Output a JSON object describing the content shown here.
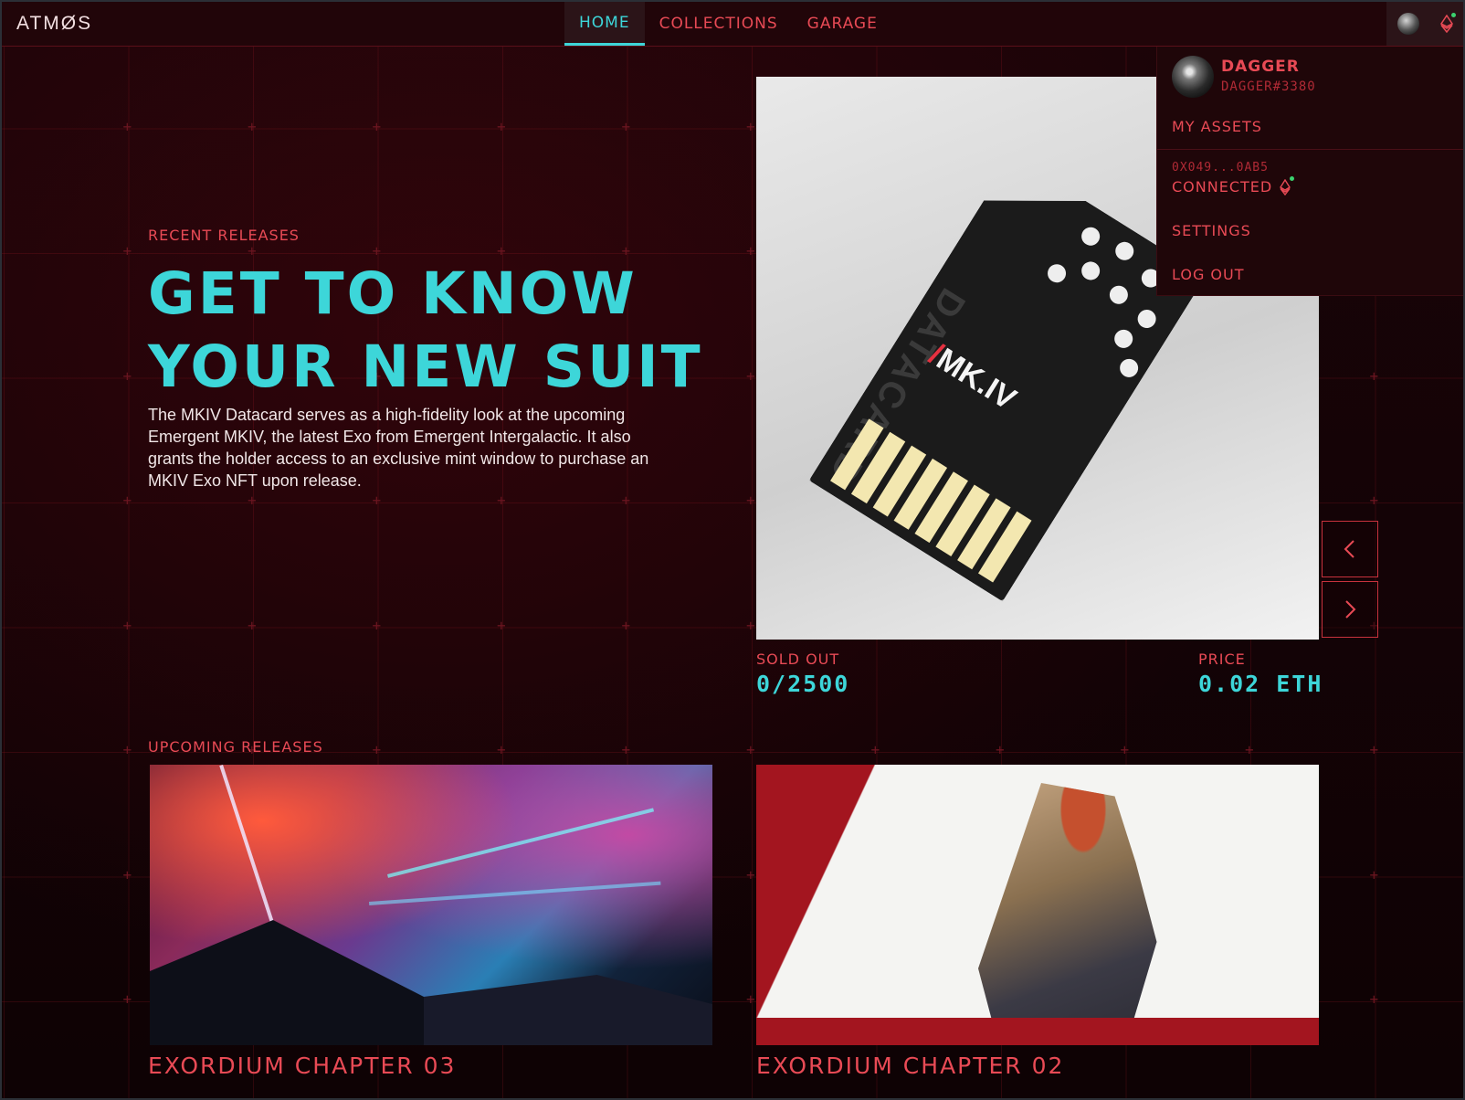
{
  "header": {
    "logo": "ATMØS",
    "nav": [
      {
        "label": "HOME",
        "active": true
      },
      {
        "label": "COLLECTIONS",
        "active": false
      },
      {
        "label": "GARAGE",
        "active": false
      }
    ],
    "wallet_status_color": "#3bd26f"
  },
  "hero": {
    "eyebrow": "RECENT RELEASES",
    "title_line1": "GET TO KNOW",
    "title_line2": "YOUR NEW SUIT",
    "description": "The MKIV Datacard serves as a high-fidelity look at the upcoming Emergent MKIV, the latest Exo from Emergent Intergalactic. It also grants the holder access to an exclusive mint window to purchase an MKIV Exo NFT upon release.",
    "card_brand": "MK.IV",
    "card_vertical": "DATACARD",
    "sold_label": "SOLD OUT",
    "sold_value": "0/2500",
    "price_label": "PRICE",
    "price_value": "0.02 ETH",
    "prev_icon": "chevron-left-icon",
    "next_icon": "chevron-right-icon"
  },
  "upcoming": {
    "eyebrow": "UPCOMING RELEASES",
    "items": [
      {
        "title": "EXORDIUM CHAPTER 03"
      },
      {
        "title": "EXORDIUM CHAPTER 02"
      }
    ]
  },
  "user_menu": {
    "name": "DAGGER",
    "tag": "DAGGER#3380",
    "my_assets": "MY ASSETS",
    "address": "0X049...0AB5",
    "connected": "CONNECTED",
    "settings": "SETTINGS",
    "logout": "LOG OUT"
  },
  "colors": {
    "accent_cyan": "#3dd6d9",
    "accent_red": "#e84a55",
    "background": "#120306"
  }
}
